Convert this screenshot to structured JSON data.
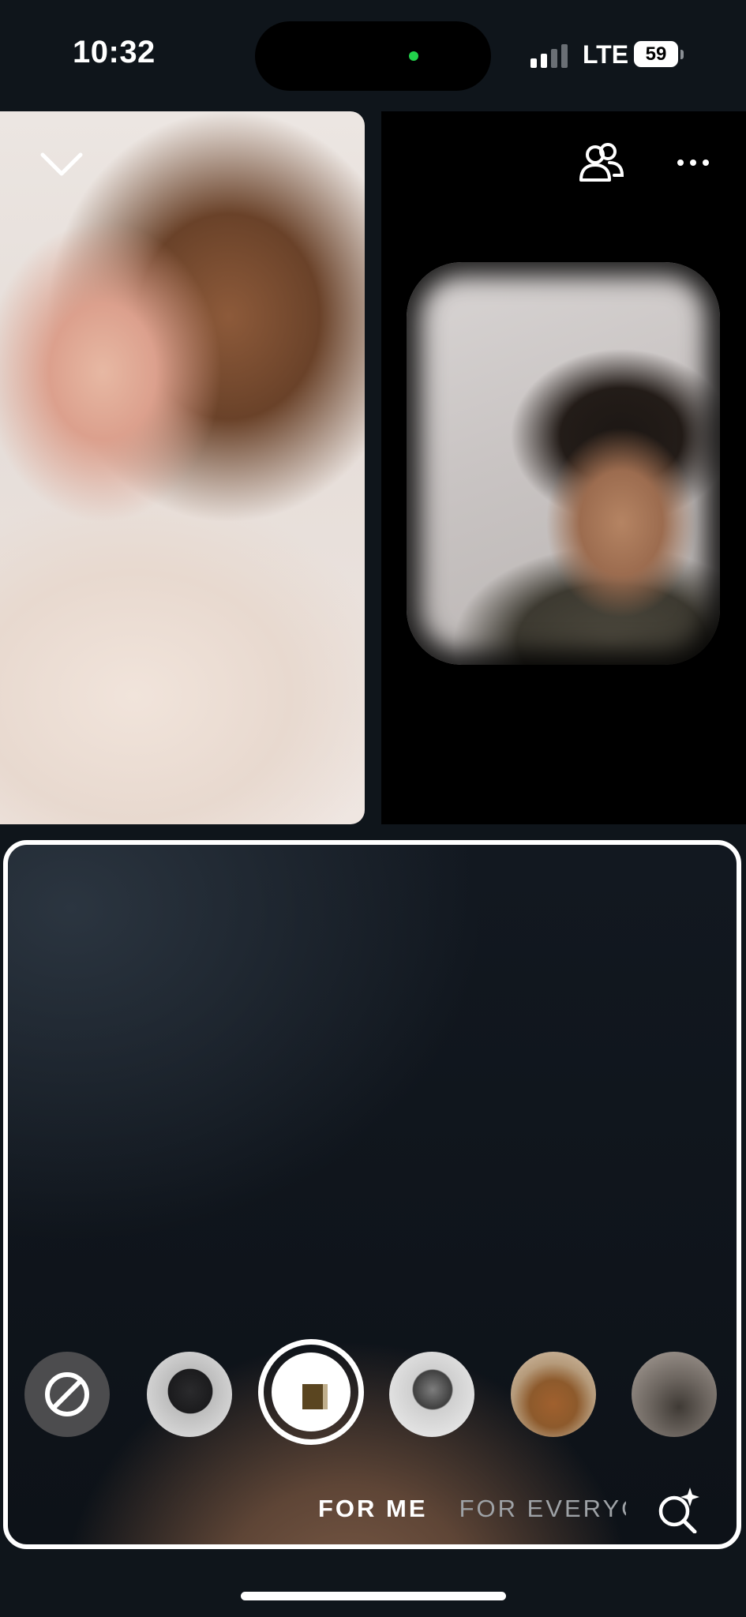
{
  "status_bar": {
    "time": "10:32",
    "network": "LTE",
    "battery": "59",
    "signal_bars": 4,
    "signal_bars_active": 2,
    "camera_indicator_color": "#22d14b"
  },
  "call": {
    "top_bar": {
      "collapse_icon": "chevron-down-icon",
      "participants_icon": "people-icon",
      "more_icon": "more-horizontal-icon"
    },
    "participants": [
      "participant-left",
      "participant-right"
    ],
    "self_view": {
      "border_color": "#ffffff"
    }
  },
  "effects": {
    "no_effect_icon": "prohibited-icon",
    "items": [
      "effect-1",
      "effect-2-selected",
      "effect-3",
      "effect-4",
      "effect-5"
    ],
    "tabs": [
      {
        "label": "FOR ME",
        "active": true
      },
      {
        "label": "FOR EVERYONE",
        "active": false
      }
    ],
    "search_icon": "sparkle-search-icon"
  }
}
